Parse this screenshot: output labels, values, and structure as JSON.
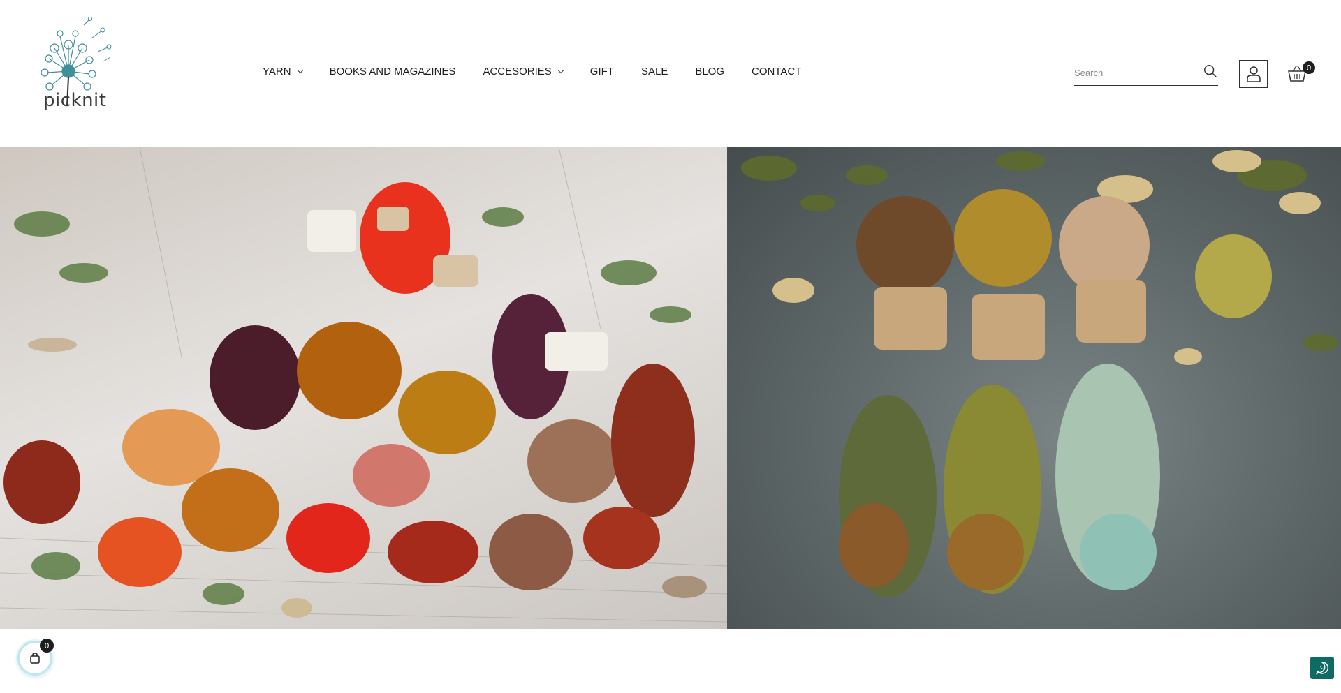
{
  "brand": {
    "name": "picknit",
    "accent": "#3e8f99"
  },
  "nav": {
    "items": [
      {
        "label": "YARN",
        "has_dropdown": true
      },
      {
        "label": "BOOKS AND MAGAZINES",
        "has_dropdown": false
      },
      {
        "label": "ACCESORIES",
        "has_dropdown": true
      },
      {
        "label": "GIFT",
        "has_dropdown": false
      },
      {
        "label": "SALE",
        "has_dropdown": false
      },
      {
        "label": "BLOG",
        "has_dropdown": false
      },
      {
        "label": "CONTACT",
        "has_dropdown": false
      }
    ]
  },
  "search": {
    "placeholder": "Search",
    "icon": "search-icon"
  },
  "account": {
    "icon": "user-icon"
  },
  "cart": {
    "icon": "basket-icon",
    "count": "0"
  },
  "hero": {
    "left_image": "hand-dyed yarn skeins pile on cracked white wood",
    "right_image": "three hand-dyed yarn skeins on grey stone"
  },
  "floating_cart": {
    "icon": "shopping-bag-icon",
    "count": "0"
  },
  "whatsapp": {
    "icon": "whatsapp-icon",
    "color": "#0d6b63"
  }
}
